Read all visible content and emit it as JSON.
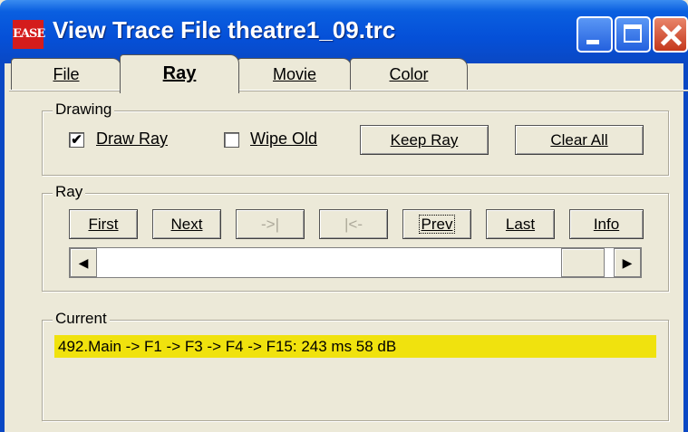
{
  "window": {
    "title": "View Trace File theatre1_09.trc",
    "app_icon_text": "EASE"
  },
  "tabs": [
    {
      "label": "File",
      "active": false
    },
    {
      "label": "Ray",
      "active": true
    },
    {
      "label": "Movie",
      "active": false
    },
    {
      "label": "Color",
      "active": false
    }
  ],
  "drawing": {
    "legend": "Drawing",
    "draw_ray_label": "Draw Ray",
    "draw_ray_checked": "✔",
    "wipe_old_label": "Wipe Old",
    "keep_ray_label": "Keep Ray",
    "clear_all_label": "Clear All"
  },
  "ray": {
    "legend": "Ray",
    "first_label": "First",
    "next_label": "Next",
    "end_label": "->|",
    "start_label": "|<-",
    "prev_label": "Prev",
    "last_label": "Last",
    "info_label": "Info",
    "scroll_left": "◀",
    "scroll_right": "▶"
  },
  "current": {
    "legend": "Current",
    "value": "492.Main -> F1 -> F3 -> F4 -> F15: 243 ms 58 dB",
    "highlight_color": "#f0e20e"
  }
}
